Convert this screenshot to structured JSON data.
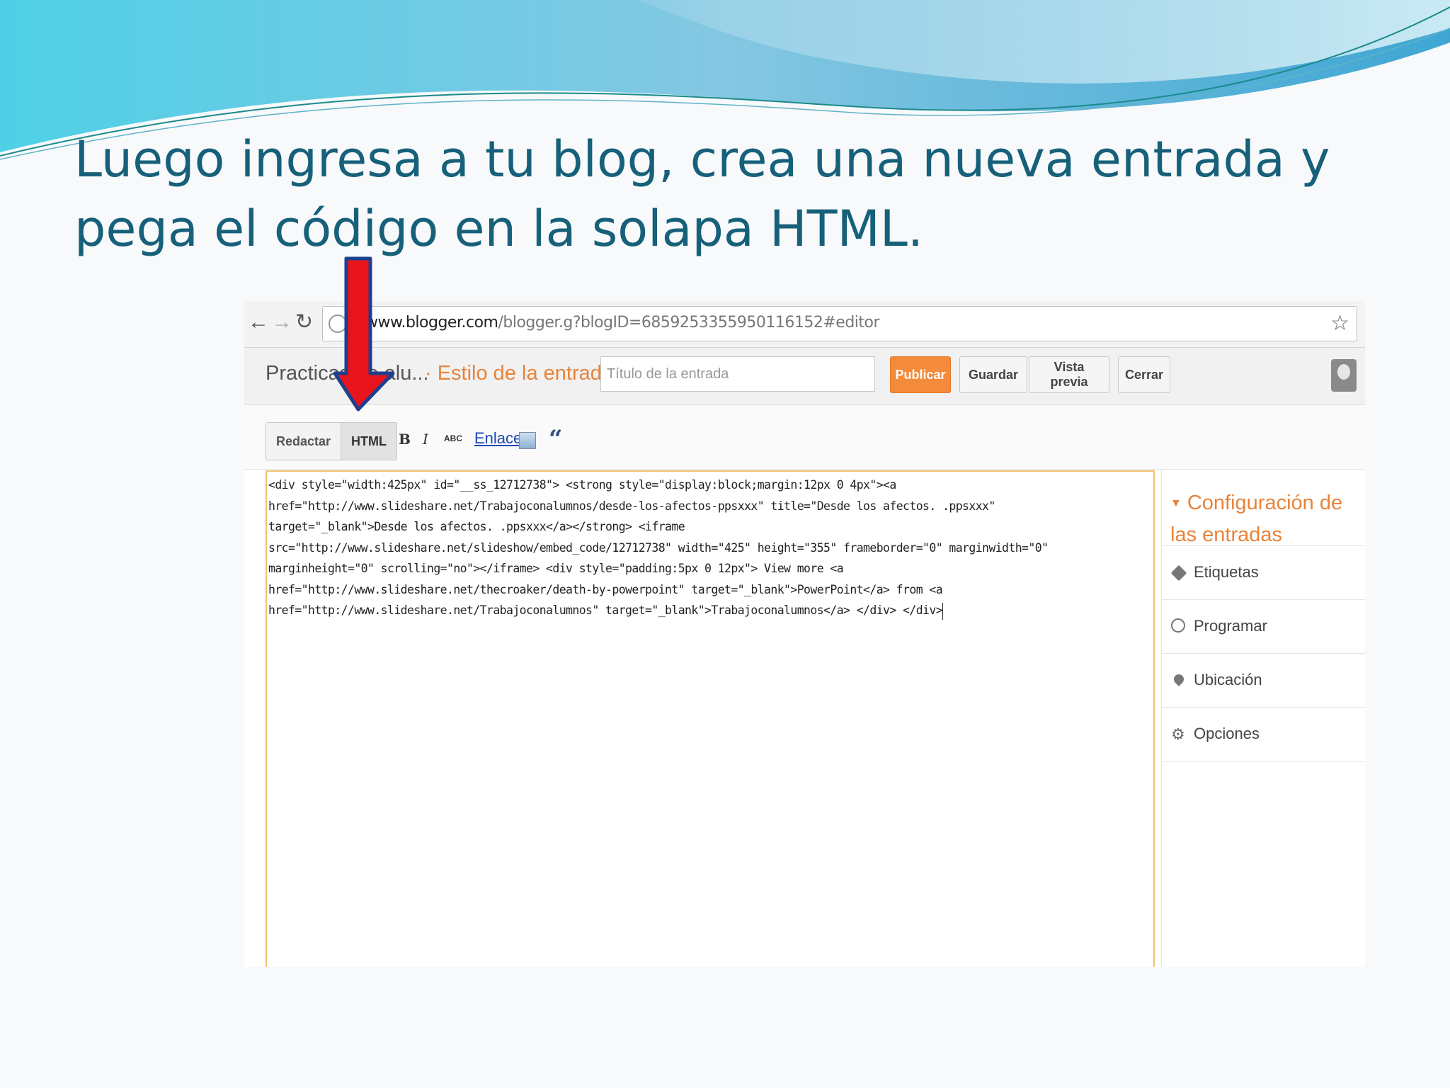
{
  "slide": {
    "title_line1": "Luego ingresa a tu blog, crea una nueva entrada y",
    "title_line2": "pega el código en la solapa HTML."
  },
  "browser": {
    "back_icon": "arrow-left-icon",
    "forward_icon": "arrow-right-icon",
    "reload_icon": "reload-icon",
    "url_host": "www.blogger.com",
    "url_path": "/blogger.g?blogID=6859253355950116152#editor",
    "bookmark_icon": "star-icon"
  },
  "editor_header": {
    "blog_name": "Practicas de alu...",
    "post_style_label": "· Estilo de la entrada",
    "title_placeholder": "Título de la entrada",
    "publish_label": "Publicar",
    "save_label": "Guardar",
    "preview_label": "Vista previa",
    "close_label": "Cerrar"
  },
  "format_bar": {
    "compose_tab": "Redactar",
    "html_tab": "HTML",
    "active_tab": "HTML",
    "bold": "B",
    "italic": "I",
    "spellcheck": "ABC",
    "link_label": "Enlace",
    "image_icon": "image-icon",
    "quote_icon": "quote-icon"
  },
  "editor": {
    "code_lines": [
      "<div style=\"width:425px\" id=\"__ss_12712738\"> <strong style=\"display:block;margin:12px 0 4px\"><a",
      "href=\"http://www.slideshare.net/Trabajoconalumnos/desde-los-afectos-ppsxxx\" title=\"Desde los afectos. .ppsxxx\"",
      "target=\"_blank\">Desde los afectos. .ppsxxx</a></strong> <iframe",
      "src=\"http://www.slideshare.net/slideshow/embed_code/12712738\" width=\"425\" height=\"355\" frameborder=\"0\" marginwidth=\"0\"",
      "marginheight=\"0\" scrolling=\"no\"></iframe> <div style=\"padding:5px 0 12px\"> View more <a",
      "href=\"http://www.slideshare.net/thecroaker/death-by-powerpoint\" target=\"_blank\">PowerPoint</a> from <a",
      "href=\"http://www.slideshare.net/Trabajoconalumnos\" target=\"_blank\">Trabajoconalumnos</a> </div> </div>"
    ]
  },
  "sidebar": {
    "header": "Configuración de las entradas",
    "items": [
      {
        "label": "Etiquetas",
        "icon": "tag-icon"
      },
      {
        "label": "Programar",
        "icon": "clock-icon"
      },
      {
        "label": "Ubicación",
        "icon": "location-pin-icon"
      },
      {
        "label": "Opciones",
        "icon": "gear-icon"
      }
    ]
  },
  "annotation": {
    "arrow_color": "#e8141b",
    "arrow_target": "HTML tab"
  },
  "colors": {
    "title": "#17607a",
    "accent_orange": "#f38b3b",
    "editor_border": "#f0c270",
    "link_blue": "#1a46b5"
  }
}
